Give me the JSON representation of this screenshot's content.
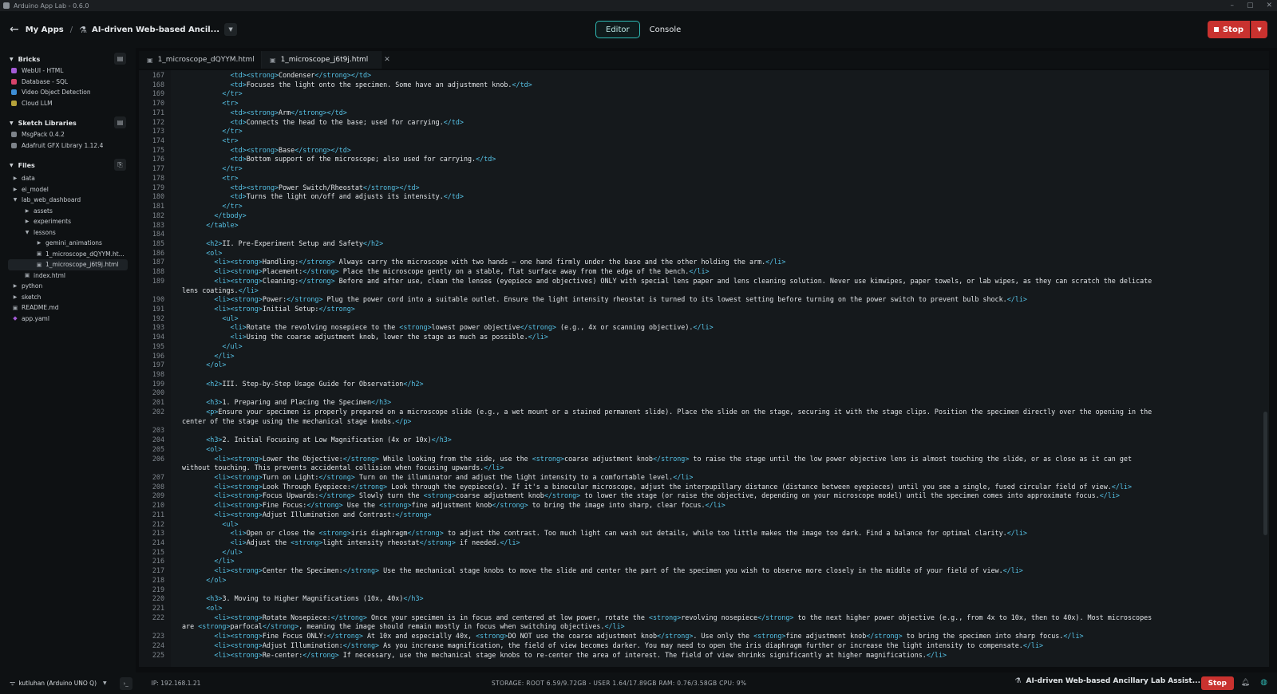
{
  "window": {
    "title": "Arduino App Lab - 0.6.0",
    "controls": [
      "–",
      "▢",
      "✕"
    ]
  },
  "header": {
    "back_icon": "←",
    "my_apps": "My Apps",
    "separator": "/",
    "app_icon": "flask-icon",
    "app_name": "AI-driven Web-based Ancil...",
    "view_editor": "Editor",
    "view_console": "Console",
    "stop_label": "Stop",
    "colors": {
      "accent": "#2fb9b4",
      "stop": "#c9322f"
    }
  },
  "sidebar": {
    "bricks": {
      "title": "Bricks",
      "items": [
        {
          "label": "WebUI - HTML",
          "color": "#a45bd6"
        },
        {
          "label": "Database - SQL",
          "color": "#d8436a"
        },
        {
          "label": "Video Object Detection",
          "color": "#3e8ed6"
        },
        {
          "label": "Cloud LLM",
          "color": "#b5a23a"
        }
      ]
    },
    "libraries": {
      "title": "Sketch Libraries",
      "items": [
        {
          "label": "MsgPack 0.4.2"
        },
        {
          "label": "Adafruit GFX Library 1.12.4"
        }
      ]
    },
    "files": {
      "title": "Files",
      "tree": [
        {
          "label": "data",
          "indent": 0,
          "kind": "folder",
          "open": false
        },
        {
          "label": "ei_model",
          "indent": 0,
          "kind": "folder",
          "open": false
        },
        {
          "label": "lab_web_dashboard",
          "indent": 0,
          "kind": "folder",
          "open": true
        },
        {
          "label": "assets",
          "indent": 1,
          "kind": "folder",
          "open": false
        },
        {
          "label": "experiments",
          "indent": 1,
          "kind": "folder",
          "open": false
        },
        {
          "label": "lessons",
          "indent": 1,
          "kind": "folder",
          "open": true
        },
        {
          "label": "gemini_animations",
          "indent": 2,
          "kind": "folder",
          "open": false
        },
        {
          "label": "1_microscope_dQYYM.ht...",
          "indent": 2,
          "kind": "file"
        },
        {
          "label": "1_microscope_j6t9j.html",
          "indent": 2,
          "kind": "file",
          "selected": true
        },
        {
          "label": "index.html",
          "indent": 1,
          "kind": "file"
        },
        {
          "label": "python",
          "indent": 0,
          "kind": "folder",
          "open": false
        },
        {
          "label": "sketch",
          "indent": 0,
          "kind": "folder",
          "open": false
        },
        {
          "label": "README.md",
          "indent": 0,
          "kind": "file"
        },
        {
          "label": "app.yaml",
          "indent": 0,
          "kind": "yaml"
        }
      ]
    }
  },
  "tabs": [
    {
      "label": "1_microscope_dQYYM.html",
      "active": false
    },
    {
      "label": "1_microscope_j6t9j.html",
      "active": true
    }
  ],
  "editor": {
    "lines": [
      {
        "n": "167",
        "ind": 12,
        "t": "<td><strong>Condenser</strong></td>"
      },
      {
        "n": "168",
        "ind": 12,
        "t": "<td>Focuses the light onto the specimen. Some have an adjustment knob.</td>"
      },
      {
        "n": "169",
        "ind": 10,
        "t": "</tr>"
      },
      {
        "n": "170",
        "ind": 10,
        "t": "<tr>"
      },
      {
        "n": "171",
        "ind": 12,
        "t": "<td><strong>Arm</strong></td>"
      },
      {
        "n": "172",
        "ind": 12,
        "t": "<td>Connects the head to the base; used for carrying.</td>"
      },
      {
        "n": "173",
        "ind": 10,
        "t": "</tr>"
      },
      {
        "n": "174",
        "ind": 10,
        "t": "<tr>"
      },
      {
        "n": "175",
        "ind": 12,
        "t": "<td><strong>Base</strong></td>"
      },
      {
        "n": "176",
        "ind": 12,
        "t": "<td>Bottom support of the microscope; also used for carrying.</td>"
      },
      {
        "n": "177",
        "ind": 10,
        "t": "</tr>"
      },
      {
        "n": "178",
        "ind": 10,
        "t": "<tr>"
      },
      {
        "n": "179",
        "ind": 12,
        "t": "<td><strong>Power Switch/Rheostat</strong></td>"
      },
      {
        "n": "180",
        "ind": 12,
        "t": "<td>Turns the light on/off and adjusts its intensity.</td>"
      },
      {
        "n": "181",
        "ind": 10,
        "t": "</tr>"
      },
      {
        "n": "182",
        "ind": 8,
        "t": "</tbody>"
      },
      {
        "n": "183",
        "ind": 6,
        "t": "</table>"
      },
      {
        "n": "184",
        "ind": 0,
        "t": ""
      },
      {
        "n": "185",
        "ind": 6,
        "t": "<h2>II. Pre-Experiment Setup and Safety</h2>"
      },
      {
        "n": "186",
        "ind": 6,
        "t": "<ol>"
      },
      {
        "n": "187",
        "ind": 8,
        "t": "<li><strong>Handling:</strong> Always carry the microscope with two hands – one hand firmly under the base and the other holding the arm.</li>"
      },
      {
        "n": "188",
        "ind": 8,
        "t": "<li><strong>Placement:</strong> Place the microscope gently on a stable, flat surface away from the edge of the bench.</li>"
      },
      {
        "n": "189",
        "ind": 8,
        "t": "<li><strong>Cleaning:</strong> Before and after use, clean the lenses (eyepiece and objectives) ONLY with special lens paper and lens cleaning solution. Never use kimwipes, paper towels, or lab wipes, as they can scratch the delicate"
      },
      {
        "n": "",
        "ind": 0,
        "t": "lens coatings.</li>"
      },
      {
        "n": "190",
        "ind": 8,
        "t": "<li><strong>Power:</strong> Plug the power cord into a suitable outlet. Ensure the light intensity rheostat is turned to its lowest setting before turning on the power switch to prevent bulb shock.</li>"
      },
      {
        "n": "191",
        "ind": 8,
        "t": "<li><strong>Initial Setup:</strong>"
      },
      {
        "n": "192",
        "ind": 10,
        "t": "<ul>"
      },
      {
        "n": "193",
        "ind": 12,
        "t": "<li>Rotate the revolving nosepiece to the <strong>lowest power objective</strong> (e.g., 4x or scanning objective).</li>"
      },
      {
        "n": "194",
        "ind": 12,
        "t": "<li>Using the coarse adjustment knob, lower the stage as much as possible.</li>"
      },
      {
        "n": "195",
        "ind": 10,
        "t": "</ul>"
      },
      {
        "n": "196",
        "ind": 8,
        "t": "</li>"
      },
      {
        "n": "197",
        "ind": 6,
        "t": "</ol>"
      },
      {
        "n": "198",
        "ind": 0,
        "t": ""
      },
      {
        "n": "199",
        "ind": 6,
        "t": "<h2>III. Step-by-Step Usage Guide for Observation</h2>"
      },
      {
        "n": "200",
        "ind": 0,
        "t": ""
      },
      {
        "n": "201",
        "ind": 6,
        "t": "<h3>1. Preparing and Placing the Specimen</h3>"
      },
      {
        "n": "202",
        "ind": 6,
        "t": "<p>Ensure your specimen is properly prepared on a microscope slide (e.g., a wet mount or a stained permanent slide). Place the slide on the stage, securing it with the stage clips. Position the specimen directly over the opening in the"
      },
      {
        "n": "",
        "ind": 0,
        "t": "center of the stage using the mechanical stage knobs.</p>"
      },
      {
        "n": "203",
        "ind": 0,
        "t": ""
      },
      {
        "n": "204",
        "ind": 6,
        "t": "<h3>2. Initial Focusing at Low Magnification (4x or 10x)</h3>"
      },
      {
        "n": "205",
        "ind": 6,
        "t": "<ol>"
      },
      {
        "n": "206",
        "ind": 8,
        "t": "<li><strong>Lower the Objective:</strong> While looking from the side, use the <strong>coarse adjustment knob</strong> to raise the stage until the low power objective lens is almost touching the slide, or as close as it can get"
      },
      {
        "n": "",
        "ind": 0,
        "t": "without touching. This prevents accidental collision when focusing upwards.</li>"
      },
      {
        "n": "207",
        "ind": 8,
        "t": "<li><strong>Turn on Light:</strong> Turn on the illuminator and adjust the light intensity to a comfortable level.</li>"
      },
      {
        "n": "208",
        "ind": 8,
        "t": "<li><strong>Look Through Eyepiece:</strong> Look through the eyepiece(s). If it's a binocular microscope, adjust the interpupillary distance (distance between eyepieces) until you see a single, fused circular field of view.</li>"
      },
      {
        "n": "209",
        "ind": 8,
        "t": "<li><strong>Focus Upwards:</strong> Slowly turn the <strong>coarse adjustment knob</strong> to lower the stage (or raise the objective, depending on your microscope model) until the specimen comes into approximate focus.</li>"
      },
      {
        "n": "210",
        "ind": 8,
        "t": "<li><strong>Fine Focus:</strong> Use the <strong>fine adjustment knob</strong> to bring the image into sharp, clear focus.</li>"
      },
      {
        "n": "211",
        "ind": 8,
        "t": "<li><strong>Adjust Illumination and Contrast:</strong>"
      },
      {
        "n": "212",
        "ind": 10,
        "t": "<ul>"
      },
      {
        "n": "213",
        "ind": 12,
        "t": "<li>Open or close the <strong>iris diaphragm</strong> to adjust the contrast. Too much light can wash out details, while too little makes the image too dark. Find a balance for optimal clarity.</li>"
      },
      {
        "n": "214",
        "ind": 12,
        "t": "<li>Adjust the <strong>light intensity rheostat</strong> if needed.</li>"
      },
      {
        "n": "215",
        "ind": 10,
        "t": "</ul>"
      },
      {
        "n": "216",
        "ind": 8,
        "t": "</li>"
      },
      {
        "n": "217",
        "ind": 8,
        "t": "<li><strong>Center the Specimen:</strong> Use the mechanical stage knobs to move the slide and center the part of the specimen you wish to observe more closely in the middle of your field of view.</li>"
      },
      {
        "n": "218",
        "ind": 6,
        "t": "</ol>"
      },
      {
        "n": "219",
        "ind": 0,
        "t": ""
      },
      {
        "n": "220",
        "ind": 6,
        "t": "<h3>3. Moving to Higher Magnifications (10x, 40x)</h3>"
      },
      {
        "n": "221",
        "ind": 6,
        "t": "<ol>"
      },
      {
        "n": "222",
        "ind": 8,
        "t": "<li><strong>Rotate Nosepiece:</strong> Once your specimen is in focus and centered at low power, rotate the <strong>revolving nosepiece</strong> to the next higher power objective (e.g., from 4x to 10x, then to 40x). Most microscopes"
      },
      {
        "n": "",
        "ind": 0,
        "t": "are <strong>parfocal</strong>, meaning the image should remain mostly in focus when switching objectives.</li>"
      },
      {
        "n": "223",
        "ind": 8,
        "t": "<li><strong>Fine Focus ONLY:</strong> At 10x and especially 40x, <strong>DO NOT use the coarse adjustment knob</strong>. Use only the <strong>fine adjustment knob</strong> to bring the specimen into sharp focus.</li>"
      },
      {
        "n": "224",
        "ind": 8,
        "t": "<li><strong>Adjust Illumination:</strong> As you increase magnification, the field of view becomes darker. You may need to open the iris diaphragm further or increase the light intensity to compensate.</li>"
      },
      {
        "n": "225",
        "ind": 8,
        "t": "<li><strong>Re-center:</strong> If necessary, use the mechanical stage knobs to re-center the area of interest. The field of view shrinks significantly at higher magnifications.</li>"
      }
    ]
  },
  "statusbar": {
    "device": "kutluhan (Arduino UNO Q)",
    "ip": "IP: 192.168.1.21",
    "stats": "STORAGE: ROOT 6.59/9.72GB - USER 1.64/17.89GB   RAM: 0.76/3.58GB   CPU: 9%",
    "running_app": "AI-driven Web-based Ancillary Lab Assist...",
    "stop_label": "Stop"
  }
}
